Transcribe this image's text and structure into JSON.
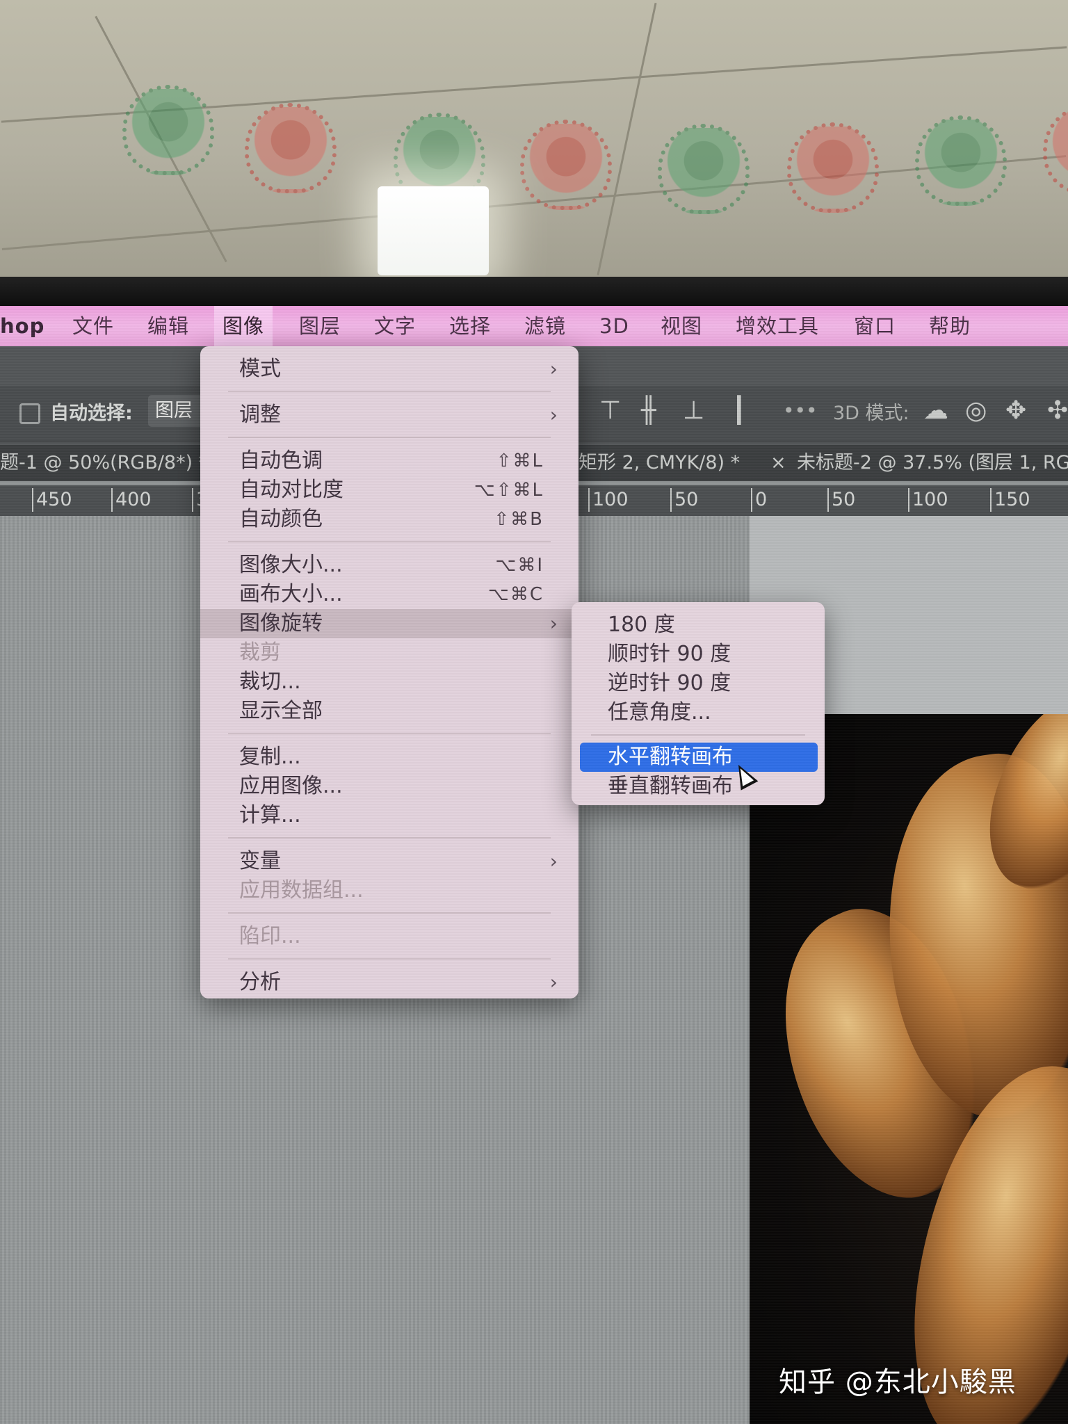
{
  "menubar": {
    "app_name": "hop",
    "items": [
      "文件",
      "编辑",
      "图像",
      "图层",
      "文字",
      "选择",
      "滤镜",
      "3D",
      "视图",
      "增效工具",
      "窗口",
      "帮助"
    ],
    "active_item": "图像"
  },
  "options": {
    "auto_select_label": "自动选择:",
    "auto_select_value": "图层",
    "more_label": "•••",
    "mode_3d_label": "3D 模式:"
  },
  "tabs": [
    "题-1 @ 50%(RGB/8*) *",
    "矩形 2, CMYK/8) *",
    "未标题-2 @ 37.5% (图层 1, RG"
  ],
  "tab_close_glyph": "×",
  "ruler": [
    "450",
    "400",
    "3",
    "100",
    "50",
    "0",
    "50",
    "100",
    "150"
  ],
  "image_menu": {
    "mode": "模式",
    "adjust": "调整",
    "auto_tone": "自动色调",
    "auto_tone_shortcut": "⇧⌘L",
    "auto_contrast": "自动对比度",
    "auto_contrast_shortcut": "⌥⇧⌘L",
    "auto_color": "自动颜色",
    "auto_color_shortcut": "⇧⌘B",
    "image_size": "图像大小...",
    "image_size_shortcut": "⌥⌘I",
    "canvas_size": "画布大小...",
    "canvas_size_shortcut": "⌥⌘C",
    "image_rotation": "图像旋转",
    "crop": "裁剪",
    "trim": "裁切...",
    "reveal_all": "显示全部",
    "duplicate": "复制...",
    "apply_image": "应用图像...",
    "calculations": "计算...",
    "variables": "变量",
    "apply_data_set": "应用数据组...",
    "trap": "陷印...",
    "analysis": "分析",
    "submenu_arrow": "›"
  },
  "rotation_submenu": {
    "rotate_180": "180 度",
    "rotate_cw": "顺时针 90 度",
    "rotate_ccw": "逆时针 90 度",
    "arbitrary": "任意角度...",
    "flip_horizontal": "水平翻转画布",
    "flip_vertical": "垂直翻转画布"
  },
  "watermark": "知乎 @东北小駿黑",
  "colors": {
    "menubar": "#f1b7e6",
    "menu_bg": "#e2d2dc",
    "selection": "#2f6ee6"
  }
}
